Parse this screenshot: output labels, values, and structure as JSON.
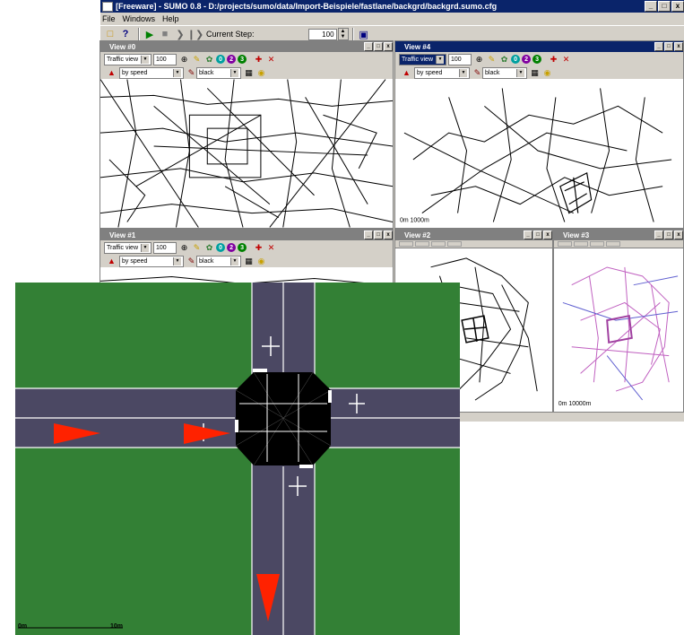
{
  "window": {
    "title": "[Freeware] - SUMO 0.8 - D:/projects/sumo/data/Import-Beispiele/fastlane/backgrd/backgrd.sumo.cfg",
    "buttons": [
      "_",
      "□",
      "x"
    ]
  },
  "menu": {
    "items": [
      "File",
      "Windows",
      "Help"
    ]
  },
  "toolbar": {
    "current_step_label": "Current Step:",
    "current_step_value": "100"
  },
  "view_buttons": [
    "_",
    "□",
    "x"
  ],
  "views": [
    {
      "title": "View #0",
      "mode": "Traffic view",
      "number": "100",
      "color_by": "by speed",
      "color": "black",
      "scale_text": ""
    },
    {
      "title": "View #4",
      "mode": "Traffic view",
      "number": "100",
      "color_by": "by speed",
      "color": "black",
      "scale_text": "0m  1000m"
    },
    {
      "title": "View #1",
      "mode": "Traffic view",
      "number": "100",
      "color_by": "by speed",
      "color": "black",
      "scale_text": ""
    },
    {
      "title": "View #2",
      "scale_text": ""
    },
    {
      "title": "View #3",
      "scale_text": "0m  10000m"
    }
  ],
  "circle_buttons": [
    "0",
    "2",
    "3"
  ],
  "icons": [
    "open-icon",
    "help-icon",
    "play-icon",
    "stop-icon",
    "step-icon",
    "step-forward-icon",
    "window-icon",
    "center-icon",
    "ruler-icon",
    "vehicle-icon",
    "locate-icon",
    "chart-icon",
    "tool-icon",
    "grid-icon",
    "bubble-icon"
  ],
  "intersection": {
    "scale_left": "0m",
    "scale_right": "10m",
    "colors": {
      "grass": "#338035",
      "road": "#4b4863",
      "junction": "#000000",
      "arrow": "#ff2200"
    }
  }
}
